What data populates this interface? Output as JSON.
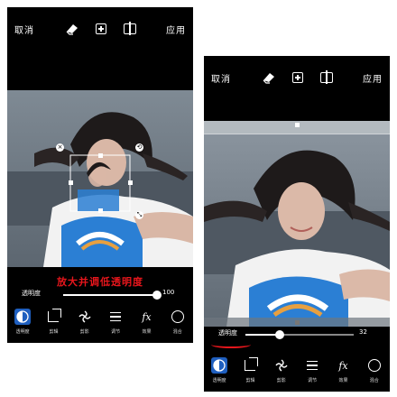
{
  "left": {
    "topbar": {
      "cancel": "取消",
      "apply": "应用"
    },
    "banner": "放大并调低透明度",
    "slider": {
      "label": "透明度",
      "value": "100",
      "fraction": 1.0
    },
    "tools": [
      {
        "label": "透明度",
        "icon": "opacity-icon"
      },
      {
        "label": "剪辑",
        "icon": "crop-icon"
      },
      {
        "label": "剪影",
        "icon": "shape-icon"
      },
      {
        "label": "调节",
        "icon": "adjust-icon"
      },
      {
        "label": "效果",
        "icon": "fx-icon"
      },
      {
        "label": "混合",
        "icon": "blend-icon"
      }
    ]
  },
  "right": {
    "topbar": {
      "cancel": "取消",
      "apply": "应用"
    },
    "slider": {
      "label": "透明度",
      "value": "32",
      "fraction": 0.32
    },
    "tools": [
      {
        "label": "透明度",
        "icon": "opacity-icon"
      },
      {
        "label": "剪辑",
        "icon": "crop-icon"
      },
      {
        "label": "剪影",
        "icon": "shape-icon"
      },
      {
        "label": "调节",
        "icon": "adjust-icon"
      },
      {
        "label": "效果",
        "icon": "fx-icon"
      },
      {
        "label": "混合",
        "icon": "blend-icon"
      }
    ]
  },
  "colors": {
    "accent_red": "#e8161c",
    "active_tool": "#1f5fbf",
    "background": "#000000"
  }
}
